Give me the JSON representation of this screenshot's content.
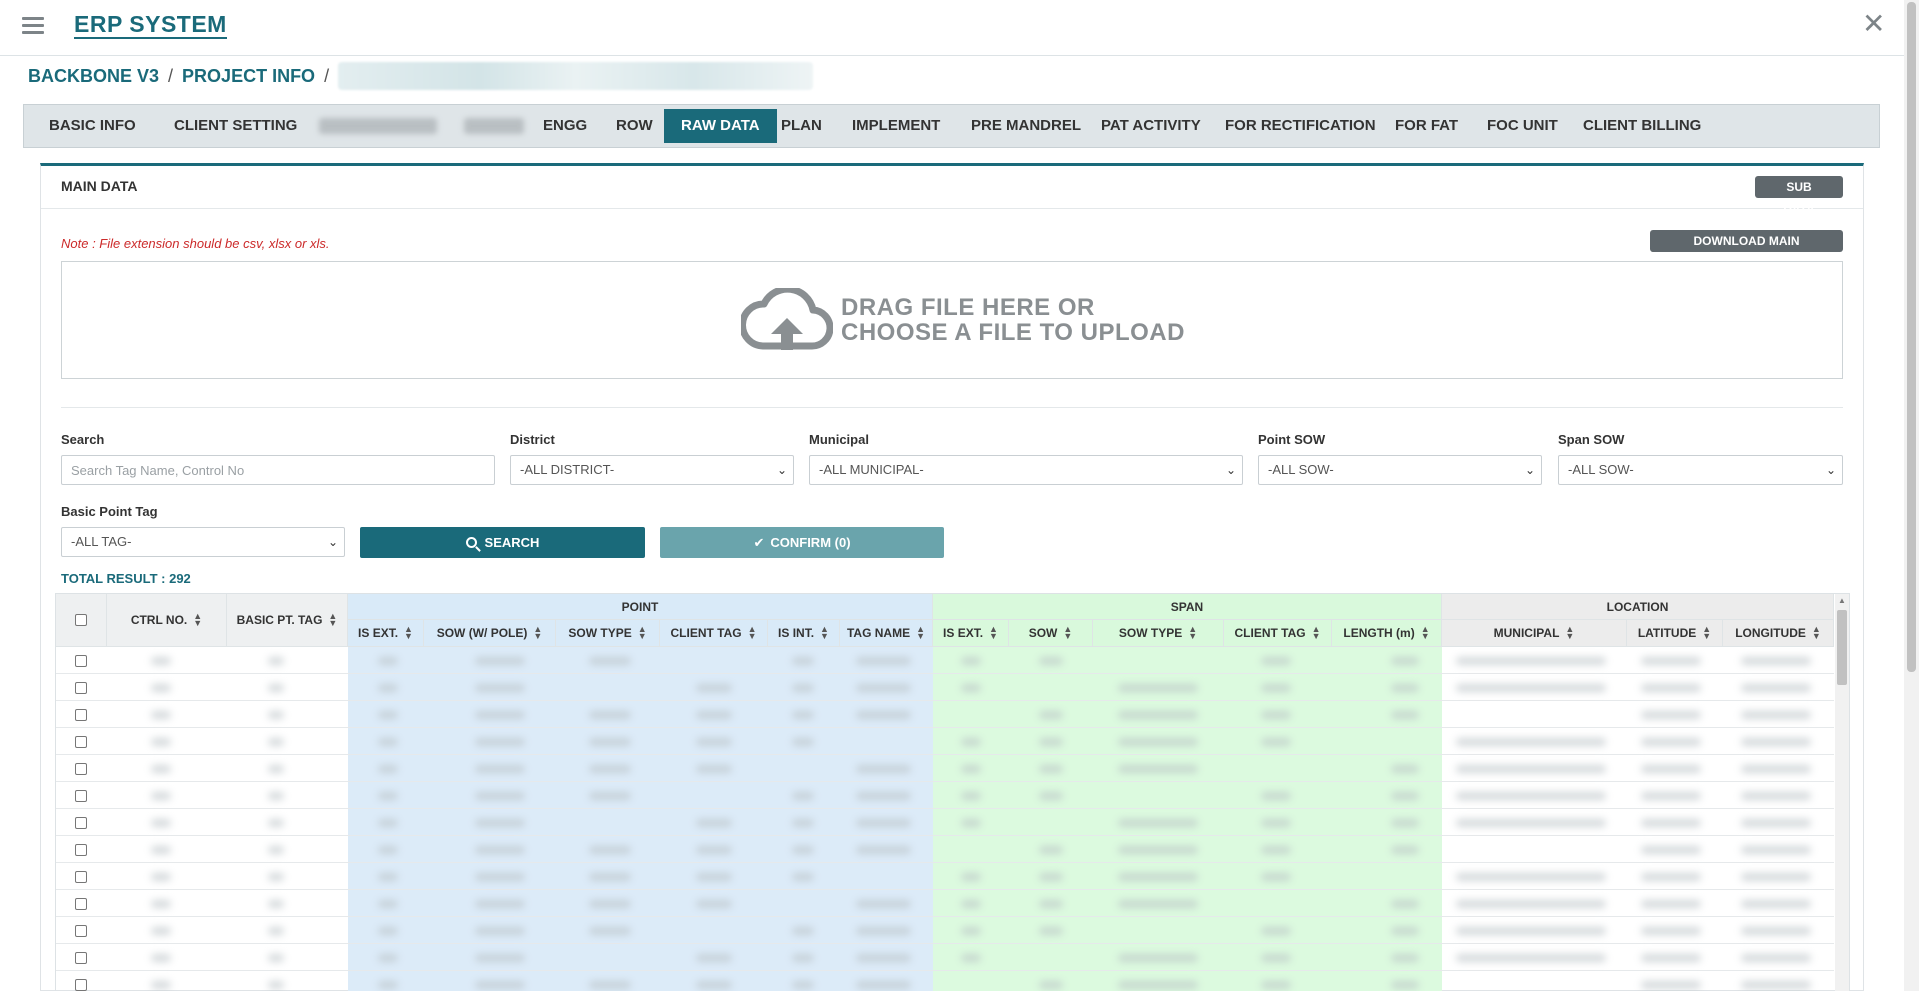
{
  "header": {
    "app_title": "ERP SYSTEM",
    "menu_icon": "hamburger-menu-icon",
    "close_icon": "close-icon"
  },
  "breadcrumb": {
    "items": [
      "BACKBONE V3",
      "PROJECT INFO"
    ],
    "separator": "/"
  },
  "tabs": [
    {
      "label": "BASIC INFO"
    },
    {
      "label": "CLIENT SETTING"
    },
    {
      "label": ""
    },
    {
      "label": ""
    },
    {
      "label": "ENGG"
    },
    {
      "label": "ROW"
    },
    {
      "label": "RAW DATA"
    },
    {
      "label": "PLAN"
    },
    {
      "label": "IMPLEMENT"
    },
    {
      "label": "PRE MANDREL"
    },
    {
      "label": "PAT ACTIVITY"
    },
    {
      "label": "FOR RECTIFICATION"
    },
    {
      "label": "FOR FAT"
    },
    {
      "label": "FOC UNIT"
    },
    {
      "label": "CLIENT BILLING"
    }
  ],
  "active_tab": "RAW DATA",
  "panel": {
    "title": "MAIN DATA",
    "sub_data_button": "SUB DATA",
    "download_button": "DOWNLOAD MAIN TEMPLATE",
    "note": "Note : File extension should be csv, xlsx or xls.",
    "dropzone_line1": "DRAG FILE HERE OR",
    "dropzone_line2": "CHOOSE A FILE TO UPLOAD"
  },
  "filters": {
    "search_label": "Search",
    "search_placeholder": "Search Tag Name, Control No",
    "district_label": "District",
    "district_value": "-ALL DISTRICT-",
    "municipal_label": "Municipal",
    "municipal_value": "-ALL MUNICIPAL-",
    "point_sow_label": "Point SOW",
    "point_sow_value": "-ALL SOW-",
    "span_sow_label": "Span SOW",
    "span_sow_value": "-ALL SOW-",
    "basic_point_tag_label": "Basic Point Tag",
    "basic_point_tag_value": "-ALL TAG-",
    "search_button": "SEARCH",
    "confirm_button": "CONFIRM (0)"
  },
  "total_result": "TOTAL RESULT : 292",
  "table": {
    "groups": {
      "point": "POINT",
      "span": "SPAN",
      "location": "LOCATION"
    },
    "columns": {
      "ctrl_no": "CTRL NO.",
      "basic_pt_tag": "BASIC PT. TAG",
      "point_is_ext": "IS EXT.",
      "point_sow": "SOW (W/ POLE)",
      "point_sow_type": "SOW TYPE",
      "point_client_tag": "CLIENT TAG",
      "point_is_int": "IS INT.",
      "point_tag_name": "TAG NAME",
      "span_is_ext": "IS EXT.",
      "span_sow": "SOW",
      "span_sow_type": "SOW TYPE",
      "span_client_tag": "CLIENT TAG",
      "span_length": "LENGTH (m)",
      "loc_municipal": "MUNICIPAL",
      "loc_latitude": "LATITUDE",
      "loc_longitude": "LONGITUDE"
    },
    "sort_icon": "⬍"
  },
  "colors": {
    "accent": "#1a6a7a",
    "point_bg": "#d9eaf8",
    "span_bg": "#d9f9dc",
    "location_bg": "#ececec",
    "note": "#cc2a2a"
  }
}
